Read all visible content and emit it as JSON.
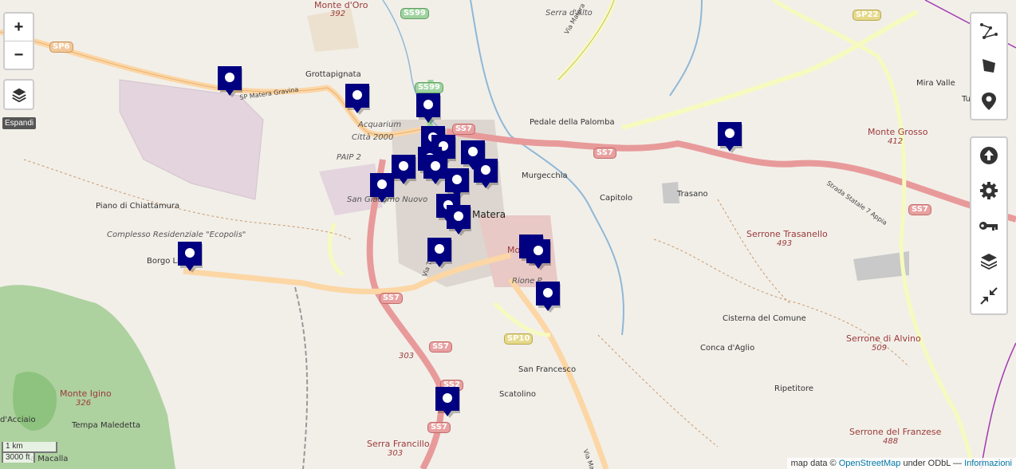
{
  "map": {
    "controls": {
      "zoom_in_label": "+",
      "zoom_out_label": "−",
      "expand_label": "Espandi"
    },
    "toolbox_top": [
      {
        "name": "draw-polyline",
        "icon": "polyline-icon"
      },
      {
        "name": "draw-polygon",
        "icon": "polygon-icon"
      },
      {
        "name": "draw-marker",
        "icon": "map-marker-icon"
      }
    ],
    "toolbox_bottom": [
      {
        "name": "upload",
        "icon": "upload-arrow-icon"
      },
      {
        "name": "settings",
        "icon": "gear-icon"
      },
      {
        "name": "key",
        "icon": "key-icon"
      },
      {
        "name": "layers",
        "icon": "layers-icon"
      },
      {
        "name": "collapse",
        "icon": "collapse-arrows-icon"
      }
    ],
    "scale": {
      "metric": "1 km",
      "imperial": "3000 ft"
    },
    "attribution": {
      "prefix": "map data © ",
      "osm_link": "OpenStreetMap",
      "middle": " under ODbL — ",
      "info_link": "Informazioni"
    },
    "marker_color": "#000080",
    "places": [
      {
        "text": "Monte d'Oro",
        "cls": "peak"
      },
      {
        "text": "392",
        "cls": "elev"
      },
      {
        "text": "Serra d'Alto",
        "cls": "it"
      },
      {
        "text": "Grottapignata",
        "cls": "town"
      },
      {
        "text": "Acquarium",
        "cls": "it"
      },
      {
        "text": "Città 2000",
        "cls": "it"
      },
      {
        "text": "PAIP 2",
        "cls": "it"
      },
      {
        "text": "San Giacomo Nuovo",
        "cls": "it"
      },
      {
        "text": "Pedale della Palomba",
        "cls": "town"
      },
      {
        "text": "Murgecchia",
        "cls": "town"
      },
      {
        "text": "Capitolo",
        "cls": "town"
      },
      {
        "text": "Trasano",
        "cls": "town"
      },
      {
        "text": "Matera",
        "cls": "city"
      },
      {
        "text": "Mira Valle",
        "cls": "town"
      },
      {
        "text": "Tup",
        "cls": "town"
      },
      {
        "text": "Monte Grosso",
        "cls": "peak"
      },
      {
        "text": "412",
        "cls": "elev"
      },
      {
        "text": "Serrone Trasanello",
        "cls": "peak"
      },
      {
        "text": "493",
        "cls": "elev"
      },
      {
        "text": "Piano di Chiattamura",
        "cls": "town"
      },
      {
        "text": "Complesso Residenziale \"Ecopolis\"",
        "cls": "it"
      },
      {
        "text": "Borgo La",
        "cls": "town"
      },
      {
        "text": "Cisterna del Comune",
        "cls": "town"
      },
      {
        "text": "Conca d'Aglio",
        "cls": "town"
      },
      {
        "text": "Serrone di Alvino",
        "cls": "peak"
      },
      {
        "text": "509",
        "cls": "elev"
      },
      {
        "text": "303",
        "cls": "elev"
      },
      {
        "text": "San Francesco",
        "cls": "town"
      },
      {
        "text": "Scatolino",
        "cls": "town"
      },
      {
        "text": "Ripetitore",
        "cls": "town"
      },
      {
        "text": "Monte Igino",
        "cls": "peak"
      },
      {
        "text": "326",
        "cls": "elev"
      },
      {
        "text": "d'Acciaio",
        "cls": "town"
      },
      {
        "text": "Tempa Maledetta",
        "cls": "town"
      },
      {
        "text": "Serra Francillo",
        "cls": "peak"
      },
      {
        "text": "303",
        "cls": "elev"
      },
      {
        "text": "Serrone del Franzese",
        "cls": "peak"
      },
      {
        "text": "488",
        "cls": "elev"
      },
      {
        "text": "Rione P",
        "cls": "it"
      },
      {
        "text": "Mo",
        "cls": "peak"
      },
      {
        "text": "a Macalla",
        "cls": "town"
      }
    ],
    "road_labels": [
      {
        "text": "SP Matera Gravina"
      },
      {
        "text": "Via Matera"
      },
      {
        "text": "Strada Statale 7 Appia"
      },
      {
        "text": "Via Timmari"
      },
      {
        "text": "Via Ma"
      }
    ],
    "shields": [
      {
        "text": "SS99",
        "cls": "g"
      },
      {
        "text": "SS99",
        "cls": "g"
      },
      {
        "text": "SP6",
        "cls": "o"
      },
      {
        "text": "SP22",
        "cls": "y"
      },
      {
        "text": "SS7",
        "cls": ""
      },
      {
        "text": "SS7",
        "cls": ""
      },
      {
        "text": "SS7",
        "cls": ""
      },
      {
        "text": "SS7",
        "cls": ""
      },
      {
        "text": "SS7",
        "cls": ""
      },
      {
        "text": "SS7",
        "cls": ""
      },
      {
        "text": "SP10",
        "cls": "y"
      },
      {
        "text": "SS2",
        "cls": ""
      }
    ]
  }
}
